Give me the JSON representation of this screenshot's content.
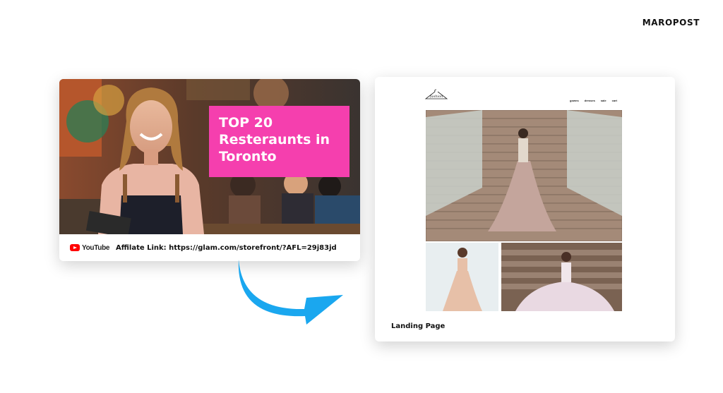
{
  "brand": {
    "name": "MAROPOST"
  },
  "left_card": {
    "promo_lines": [
      "TOP 20",
      "Resteraunts in",
      "Toronto"
    ],
    "youtube_label": "YouTube",
    "affiliate_text": "Affilate Link: https://glam.com/storefront/?AFL=29j83jd"
  },
  "right_card": {
    "logo_text": "fashion",
    "nav": [
      "gowns",
      "dresses",
      "sale",
      "cart"
    ],
    "label": "Landing Page"
  },
  "colors": {
    "promo_bg": "#f53fae",
    "arrow": "#1aa7ef",
    "youtube_red": "#ff0000"
  }
}
